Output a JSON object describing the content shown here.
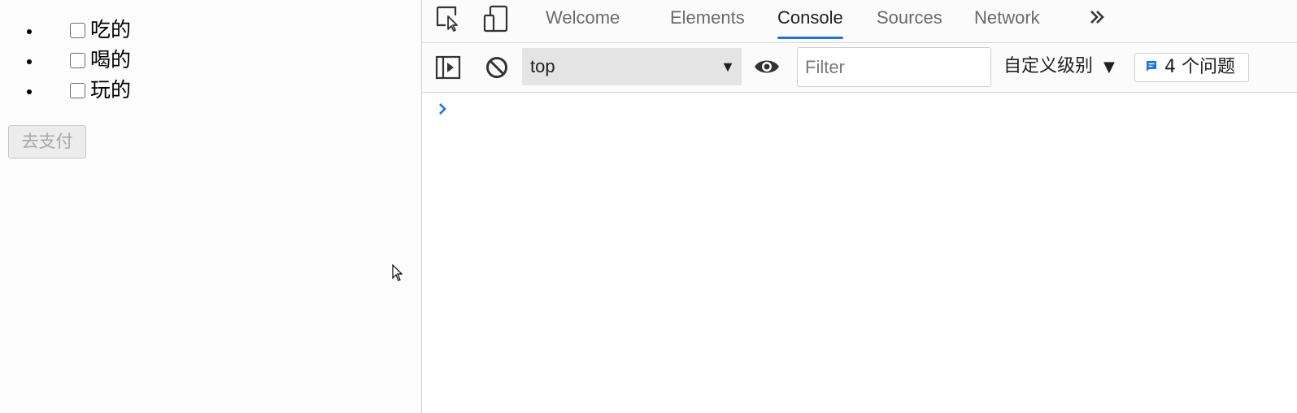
{
  "page": {
    "items": [
      {
        "label": "吃的",
        "checked": false
      },
      {
        "label": "喝的",
        "checked": false
      },
      {
        "label": "玩的",
        "checked": false
      }
    ],
    "pay_button": "去支付"
  },
  "devtools": {
    "tabs": [
      {
        "label": "Welcome",
        "active": false
      },
      {
        "label": "Elements",
        "active": false
      },
      {
        "label": "Console",
        "active": true
      },
      {
        "label": "Sources",
        "active": false
      },
      {
        "label": "Network",
        "active": false
      }
    ],
    "more_tabs_icon": "double-chevron-right-icon",
    "toolbar": {
      "context": "top",
      "filter_placeholder": "Filter",
      "level": "自定义级别",
      "issues": "4 个问题"
    },
    "colors": {
      "accent": "#1a73e8",
      "issue_icon": "#1a73e8"
    }
  }
}
